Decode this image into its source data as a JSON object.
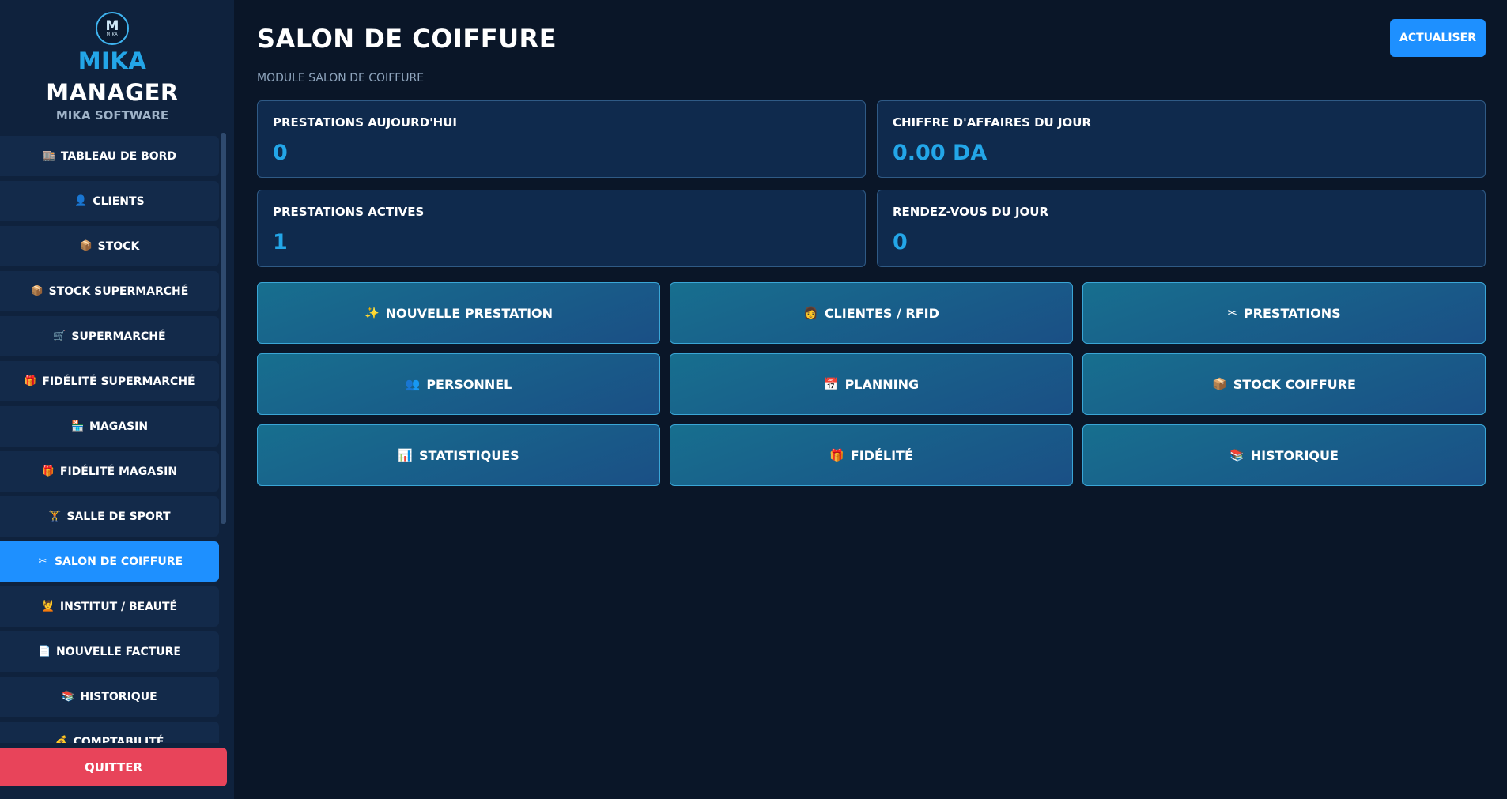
{
  "brand": {
    "logo_text": "M",
    "logo_sub": "MIKA",
    "line1": "MIKA",
    "line2": "MANAGER",
    "subtitle": "MIKA SOFTWARE"
  },
  "sidebar": {
    "items": [
      {
        "icon": "🏬",
        "label": "TABLEAU DE BORD",
        "active": false
      },
      {
        "icon": "👤",
        "label": "CLIENTS",
        "active": false
      },
      {
        "icon": "📦",
        "label": "STOCK",
        "active": false
      },
      {
        "icon": "📦",
        "label": "STOCK SUPERMARCHÉ",
        "active": false
      },
      {
        "icon": "🛒",
        "label": "SUPERMARCHÉ",
        "active": false
      },
      {
        "icon": "🎁",
        "label": "FIDÉLITÉ SUPERMARCHÉ",
        "active": false
      },
      {
        "icon": "🏪",
        "label": "MAGASIN",
        "active": false
      },
      {
        "icon": "🎁",
        "label": "FIDÉLITÉ MAGASIN",
        "active": false
      },
      {
        "icon": "🏋",
        "label": "SALLE DE SPORT",
        "active": false
      },
      {
        "icon": "✂",
        "label": "SALON DE COIFFURE",
        "active": true
      },
      {
        "icon": "💆",
        "label": "INSTITUT / BEAUTÉ",
        "active": false
      },
      {
        "icon": "📄",
        "label": "NOUVELLE FACTURE",
        "active": false
      },
      {
        "icon": "📚",
        "label": "HISTORIQUE",
        "active": false
      },
      {
        "icon": "💰",
        "label": "COMPTABILITÉ",
        "active": false
      }
    ],
    "quit_label": "QUITTER"
  },
  "header": {
    "title": "SALON DE COIFFURE",
    "subtitle": "MODULE SALON DE COIFFURE",
    "refresh_label": "ACTUALISER"
  },
  "stats": [
    {
      "label": "PRESTATIONS AUJOURD'HUI",
      "value": "0"
    },
    {
      "label": "CHIFFRE D'AFFAIRES DU JOUR",
      "value": "0.00 DA"
    },
    {
      "label": "PRESTATIONS ACTIVES",
      "value": "1"
    },
    {
      "label": "RENDEZ-VOUS DU JOUR",
      "value": "0"
    }
  ],
  "actions": [
    {
      "icon": "✨",
      "label": "NOUVELLE PRESTATION"
    },
    {
      "icon": "👩",
      "label": "CLIENTES / RFID"
    },
    {
      "icon": "✂",
      "label": "PRESTATIONS"
    },
    {
      "icon": "👥",
      "label": "PERSONNEL"
    },
    {
      "icon": "📅",
      "label": "PLANNING"
    },
    {
      "icon": "📦",
      "label": "STOCK COIFFURE"
    },
    {
      "icon": "📊",
      "label": "STATISTIQUES"
    },
    {
      "icon": "🎁",
      "label": "FIDÉLITÉ"
    },
    {
      "icon": "📚",
      "label": "HISTORIQUE"
    }
  ],
  "colors": {
    "background": "#0a1628",
    "sidebar": "#0f223d",
    "accent": "#1e90ff",
    "value": "#23a6e8",
    "danger": "#e8445a"
  }
}
